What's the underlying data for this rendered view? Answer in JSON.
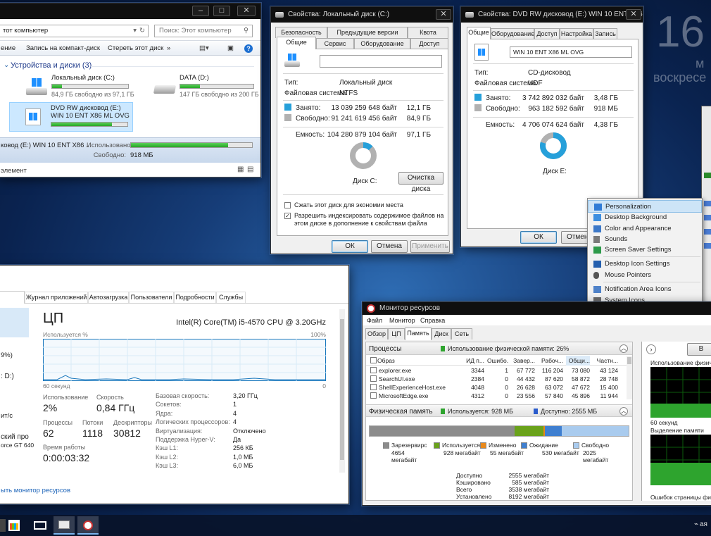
{
  "desktop": {
    "time": "16",
    "date_line1": "м",
    "date_line2": "воскресе"
  },
  "explorer": {
    "title": "",
    "address": "тот компьютер",
    "search_placeholder": "Поиск: Этот компьютер",
    "toolbar": {
      "cmd1": "ение",
      "cmd2": "Запись на компакт-диск",
      "cmd3": "Стереть этот диск",
      "more": "»"
    },
    "group_header": "Устройства и диски (3)",
    "drives": [
      {
        "name": "Локальный диск (C:)",
        "free": "84,9 ГБ свободно из 97,1 ГБ",
        "fill": 0.13
      },
      {
        "name": "DATA (D:)",
        "free": "147 ГБ свободно из 200 ГБ",
        "fill": 0.27
      },
      {
        "name": "DVD RW дисковод (E:) WIN 10 ENT X86 ML OVG",
        "fill": 0.8
      }
    ],
    "details": {
      "name": "ковод (E:) WIN 10 ENT X86 ...",
      "used_label": "Использовано:",
      "free_label": "Свободно:",
      "free_value": "918 МБ",
      "fill": 0.8
    },
    "status": "элемент"
  },
  "props_c": {
    "title": "Свойства: Локальный диск (C:)",
    "tabs_row1": [
      "Безопасность",
      "Предыдущие версии",
      "Квота"
    ],
    "tabs_row2": [
      "Общие",
      "Сервис",
      "Оборудование",
      "Доступ"
    ],
    "name_value": "",
    "type_label": "Тип:",
    "type_value": "Локальный диск",
    "fs_label": "Файловая система:",
    "fs_value": "NTFS",
    "used_label": "Занято:",
    "used_bytes": "13 039 259 648 байт",
    "used_short": "12,1 ГБ",
    "free_label": "Свободно:",
    "free_bytes": "91 241 619 456 байт",
    "free_short": "84,9 ГБ",
    "cap_label": "Емкость:",
    "cap_bytes": "104 280 879 104 байт",
    "cap_short": "97,1 ГБ",
    "used_fraction": 0.125,
    "disk_label": "Диск C:",
    "cleanup_btn": "Очистка диска",
    "compress_label": "Сжать этот диск для экономии места",
    "index_label": "Разрешить индексировать содержимое файлов на этом диске в дополнение к свойствам файла",
    "ok": "ОК",
    "cancel": "Отмена",
    "apply": "Применить"
  },
  "props_e": {
    "title": "Свойства: DVD RW дисковод (E:) WIN 10 ENT X86 M...",
    "tabs": [
      "Общие",
      "Оборудование",
      "Доступ",
      "Настройка",
      "Запись"
    ],
    "name_value": "WIN 10 ENT X86 ML OVG",
    "type_label": "Тип:",
    "type_value": "CD-дисковод",
    "fs_label": "Файловая система:",
    "fs_value": "UDF",
    "used_label": "Занято:",
    "used_bytes": "3 742 892 032 байт",
    "used_short": "3,48 ГБ",
    "free_label": "Свободно:",
    "free_bytes": "963 182 592 байт",
    "free_short": "918 МБ",
    "cap_label": "Емкость:",
    "cap_bytes": "4 706 074 624 байт",
    "cap_short": "4,38 ГБ",
    "used_fraction": 0.795,
    "disk_label": "Диск E:",
    "ok": "ОК",
    "cancel": "Отмена"
  },
  "context_menu": {
    "items": [
      "Personalization",
      "Desktop Background",
      "Color and Appearance",
      "Sounds",
      "Screen Saver Settings",
      "Desktop Icon Settings",
      "Mouse Pointers",
      "Notification Area Icons",
      "System Icons"
    ]
  },
  "taskmgr": {
    "tabs": [
      "Журнал приложений",
      "Автозагрузка",
      "Пользователи",
      "Подробности",
      "Службы"
    ],
    "left_texts": [
      "9%)",
      ": D:)",
      "ит/с",
      "ский про",
      "orce GT 640"
    ],
    "heading": "ЦП",
    "cpu_name": "Intel(R) Core(TM) i5-4570 CPU @ 3.20GHz",
    "graph_label": "Используется %",
    "graph_max": "100%",
    "graph_time": "60 секунд",
    "graph_min": "0",
    "stats": [
      {
        "label": "Использование",
        "value": "2%"
      },
      {
        "label": "Скорость",
        "value": "0,84 ГГц"
      },
      {
        "label": "Процессы",
        "value": "62"
      },
      {
        "label": "Потоки",
        "value": "1118"
      },
      {
        "label": "Дескрипторы",
        "value": "30812"
      },
      {
        "label": "Время работы",
        "value": "0:00:03:32"
      }
    ],
    "specs": [
      {
        "k": "Базовая скорость:",
        "v": "3,20 ГГц"
      },
      {
        "k": "Сокетов:",
        "v": "1"
      },
      {
        "k": "Ядра:",
        "v": "4"
      },
      {
        "k": "Логических процессоров:",
        "v": "4"
      },
      {
        "k": "Виртуализация:",
        "v": "Отключено"
      },
      {
        "k": "Поддержка Hyper-V:",
        "v": "Да"
      },
      {
        "k": "Кэш L1:",
        "v": "256 КБ"
      },
      {
        "k": "Кэш L2:",
        "v": "1,0 МБ"
      },
      {
        "k": "Кэш L3:",
        "v": "6,0 МБ"
      }
    ],
    "footer_link": "ыть монитор ресурсов"
  },
  "resmon": {
    "title": "Монитор ресурсов",
    "menu": [
      "Файл",
      "Монитор",
      "Справка"
    ],
    "tabs": [
      "Обзор",
      "ЦП",
      "Память",
      "Диск",
      "Сеть"
    ],
    "processes_header": "Процессы",
    "phys_usage": "Использование физической памяти: 26%",
    "columns": [
      "Образ",
      "ИД п...",
      "Ошибо...",
      "Завер...",
      "Рабоч...",
      "Общи...",
      "Частн..."
    ],
    "rows": [
      [
        "explorer.exe",
        "3344",
        "1",
        "67 772",
        "116 204",
        "73 080",
        "43 124"
      ],
      [
        "SearchUI.exe",
        "2384",
        "0",
        "44 432",
        "87 620",
        "58 872",
        "28 748"
      ],
      [
        "ShellExperienceHost.exe",
        "4048",
        "0",
        "26 628",
        "63 072",
        "47 672",
        "15 400"
      ],
      [
        "MicrosoftEdge.exe",
        "4312",
        "0",
        "23 556",
        "57 840",
        "45 896",
        "11 944"
      ]
    ],
    "phys_header": "Физическая память",
    "used_text": "Используется: 928 МБ",
    "avail_text": "Доступно: 2555 МБ",
    "legend": [
      {
        "name": "Зарезервировано аппаратно",
        "value": "4654 мегабайт",
        "color": "#8c8c8c"
      },
      {
        "name": "Используется",
        "value": "928 мегабайт",
        "color": "#6aa21b"
      },
      {
        "name": "Изменено",
        "value": "55 мегабайт",
        "color": "#e8881a"
      },
      {
        "name": "Ожидание",
        "value": "530 мегабайт",
        "color": "#3f7fd0"
      },
      {
        "name": "Свободно",
        "value": "2025 мегабайт",
        "color": "#a9cbee"
      }
    ],
    "summary": [
      {
        "k": "Доступно",
        "v": "2555 мегабайт"
      },
      {
        "k": "Кэшировано",
        "v": "585 мегабайт"
      },
      {
        "k": "Всего",
        "v": "3538 мегабайт"
      },
      {
        "k": "Установлено",
        "v": "8192 мегабайт"
      }
    ],
    "side_label1": "Использование физич",
    "side_time": "60 секунд",
    "side_label2": "Выделение памяти",
    "side_label3": "Ошибок страницы фи",
    "side_btn": "В"
  },
  "taskbar": {
    "right_text": "ая"
  },
  "colors": {
    "used_blue": "#26a0da",
    "free_gray": "#b1b1b1",
    "accent": "#3c7fb1"
  }
}
